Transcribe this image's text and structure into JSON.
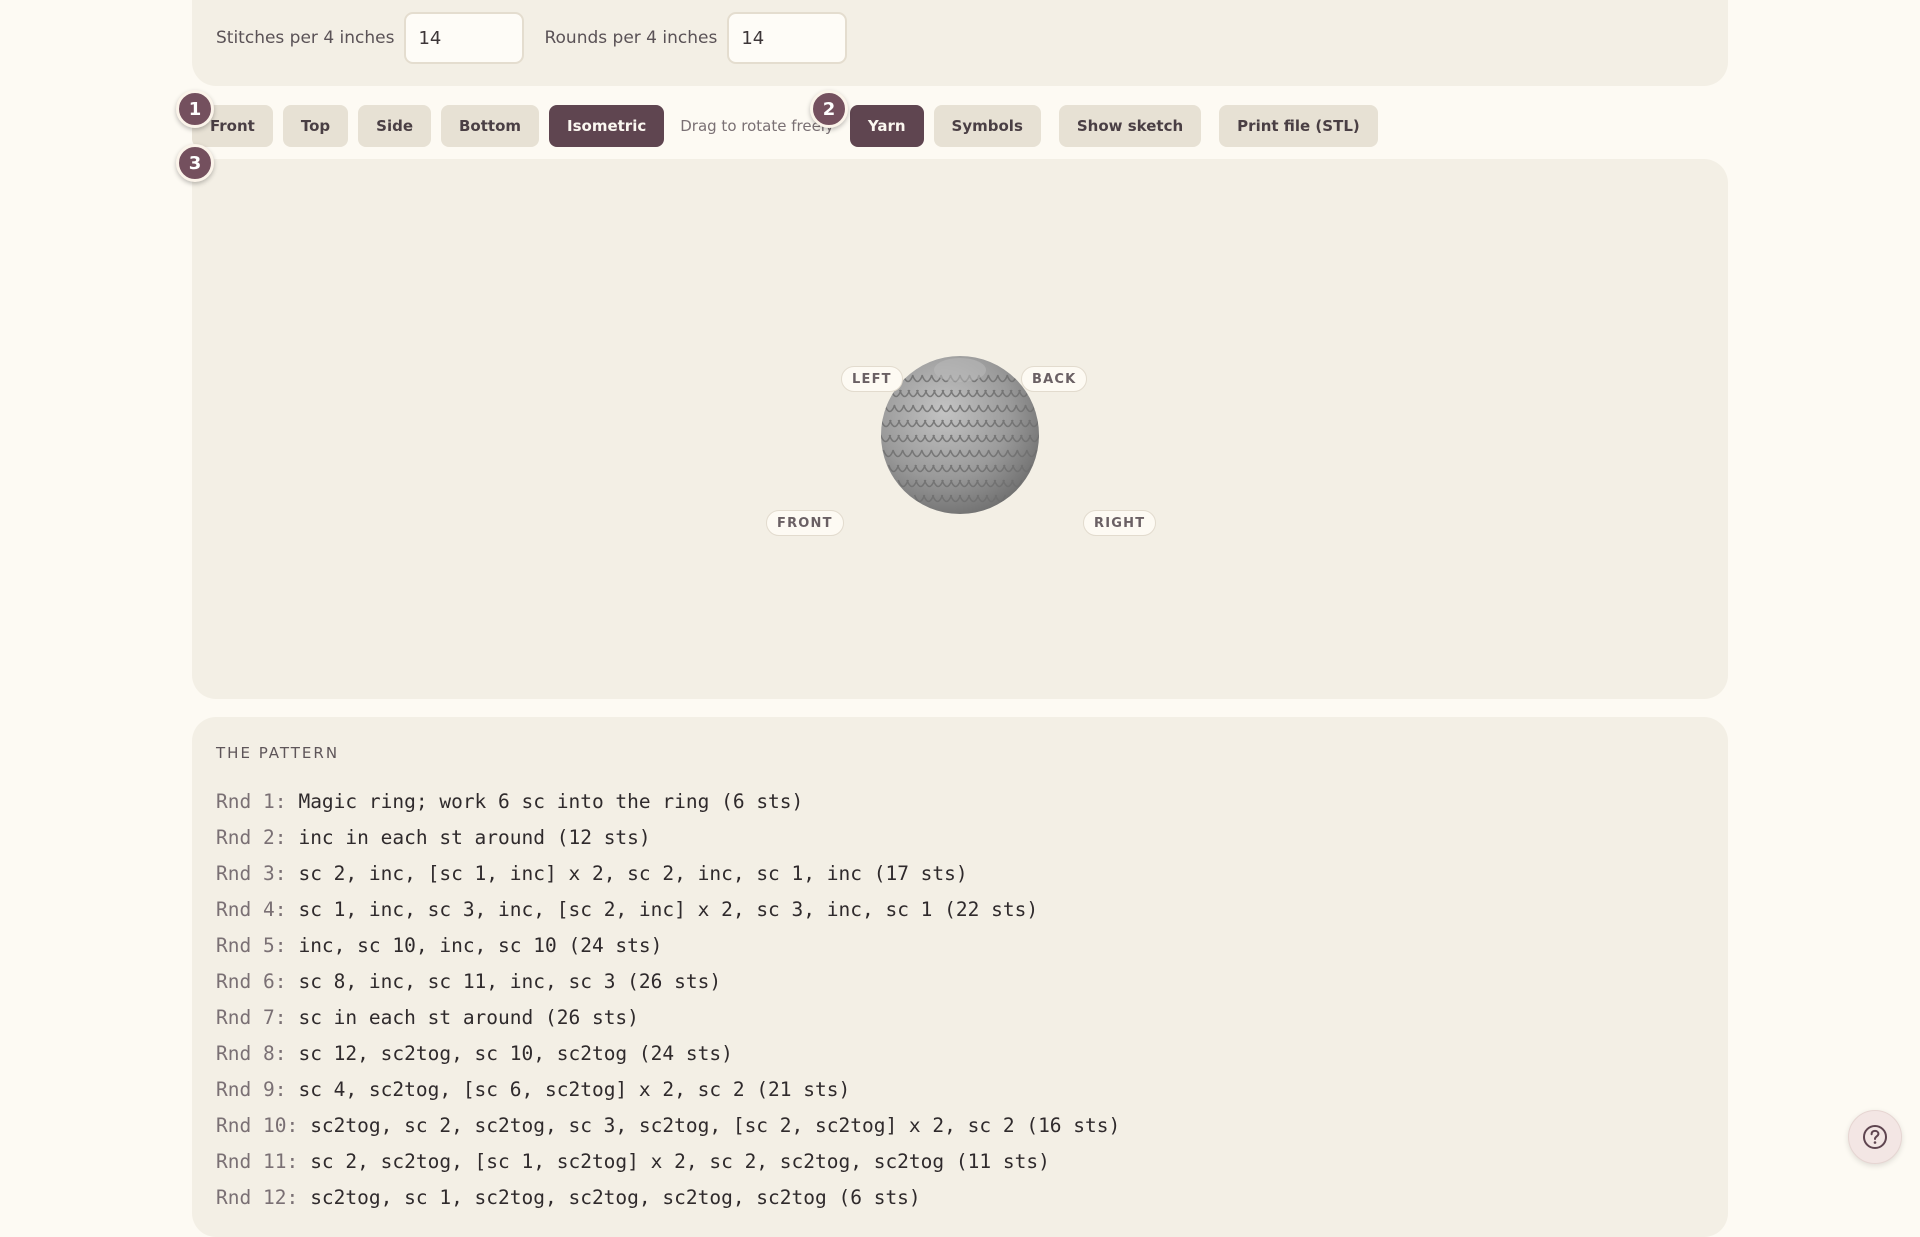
{
  "gauge": {
    "stitches_label": "Stitches per 4 inches",
    "stitches_value": "14",
    "rounds_label": "Rounds per 4 inches",
    "rounds_value": "14"
  },
  "toolbar": {
    "views": [
      "Front",
      "Top",
      "Side",
      "Bottom",
      "Isometric"
    ],
    "active_view": "Isometric",
    "drag_hint": "Drag to rotate freely",
    "render_modes": [
      "Yarn",
      "Symbols"
    ],
    "active_render_mode": "Yarn",
    "show_sketch_label": "Show sketch",
    "print_file_label": "Print file (STL)"
  },
  "badges": [
    "1",
    "2",
    "3"
  ],
  "viewer": {
    "axis_labels": {
      "left": "LEFT",
      "back": "BACK",
      "front": "FRONT",
      "right": "RIGHT"
    },
    "model_color": "#9a9a9a"
  },
  "pattern": {
    "heading": "THE PATTERN",
    "rounds": [
      {
        "label": "Rnd 1:",
        "text": "Magic ring; work 6 sc into the ring (6 sts)"
      },
      {
        "label": "Rnd 2:",
        "text": "inc in each st around (12 sts)"
      },
      {
        "label": "Rnd 3:",
        "text": "sc 2, inc, [sc 1, inc] x 2, sc 2, inc, sc 1, inc (17 sts)"
      },
      {
        "label": "Rnd 4:",
        "text": "sc 1, inc, sc 3, inc, [sc 2, inc] x 2, sc 3, inc, sc 1 (22 sts)"
      },
      {
        "label": "Rnd 5:",
        "text": "inc, sc 10, inc, sc 10 (24 sts)"
      },
      {
        "label": "Rnd 6:",
        "text": "sc 8, inc, sc 11, inc, sc 3 (26 sts)"
      },
      {
        "label": "Rnd 7:",
        "text": "sc in each st around (26 sts)"
      },
      {
        "label": "Rnd 8:",
        "text": "sc 12, sc2tog, sc 10, sc2tog (24 sts)"
      },
      {
        "label": "Rnd 9:",
        "text": "sc 4, sc2tog, [sc 6, sc2tog] x 2, sc 2 (21 sts)"
      },
      {
        "label": "Rnd 10:",
        "text": "sc2tog, sc 2, sc2tog, sc 3, sc2tog, [sc 2, sc2tog] x 2, sc 2 (16 sts)"
      },
      {
        "label": "Rnd 11:",
        "text": "sc 2, sc2tog, [sc 1, sc2tog] x 2, sc 2, sc2tog, sc2tog (11 sts)"
      },
      {
        "label": "Rnd 12:",
        "text": "sc2tog, sc 1, sc2tog, sc2tog, sc2tog, sc2tog (6 sts)"
      }
    ]
  },
  "colors": {
    "accent": "#5f4550",
    "badge": "#74505e",
    "panel": "#f3efe5",
    "page": "#fdfaf3"
  },
  "help_icon": "question-circle-icon"
}
